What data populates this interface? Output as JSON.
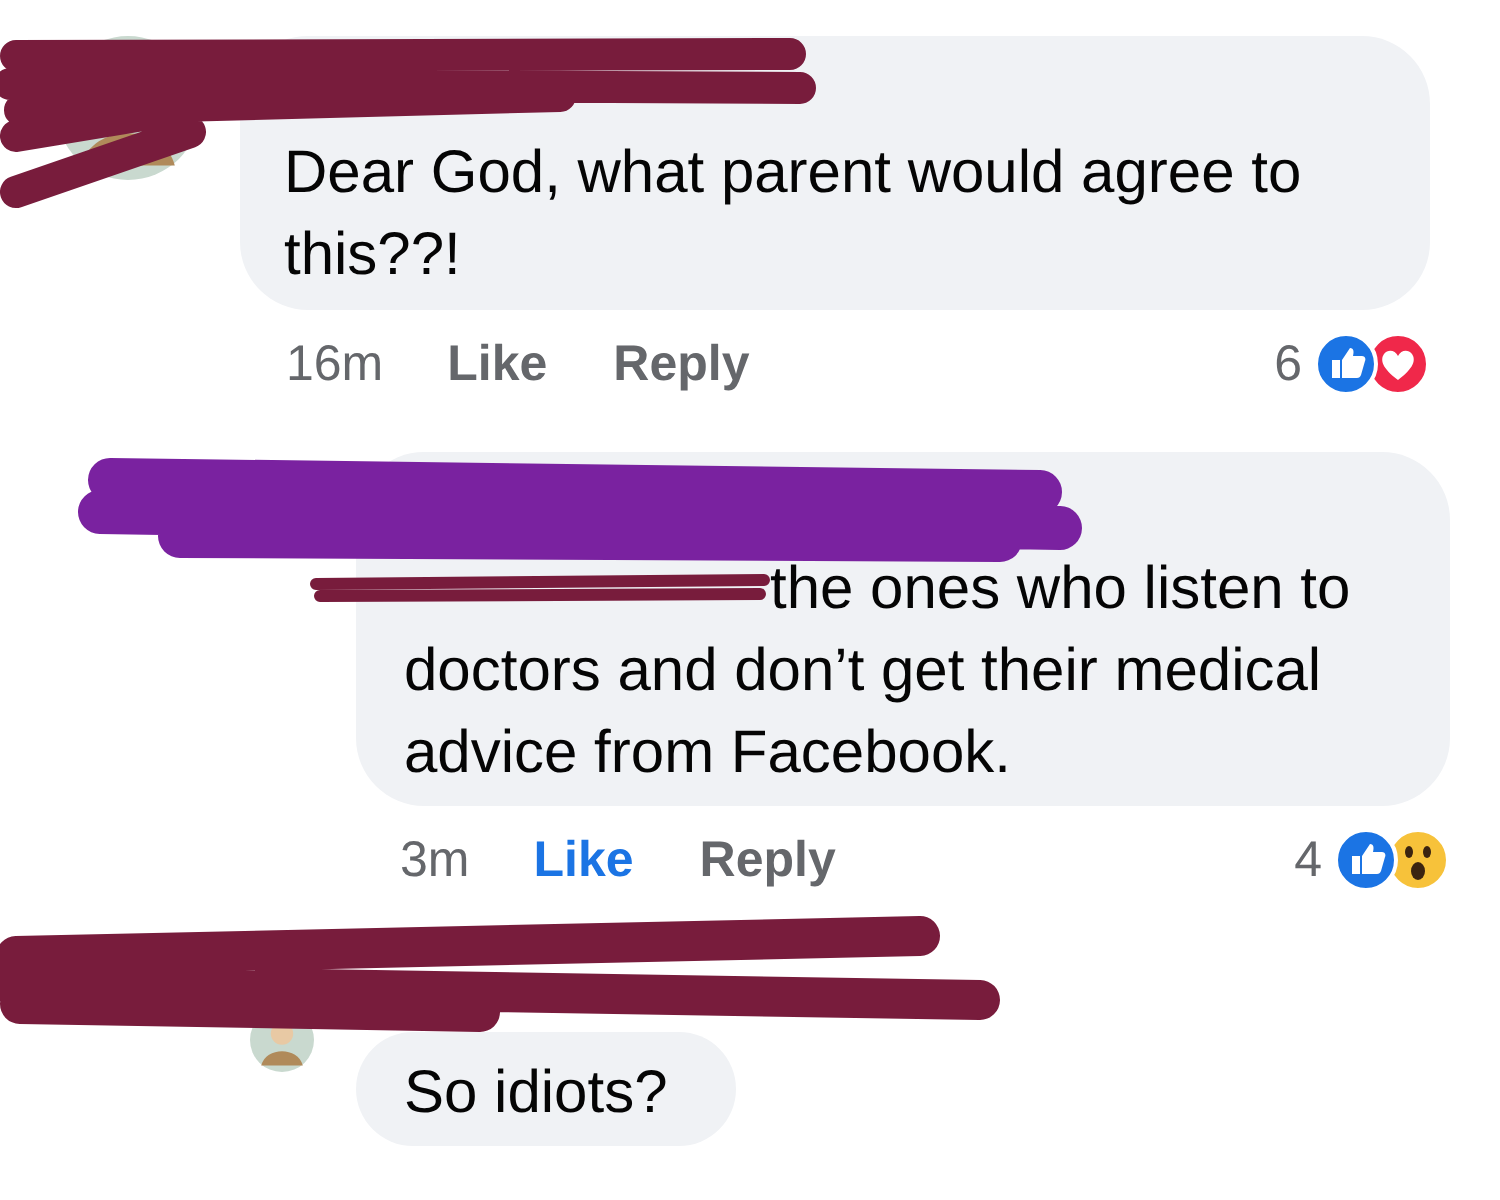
{
  "comments": [
    {
      "text": "Dear God, what parent would agree to this??!",
      "time": "16m",
      "like": "Like",
      "liked": false,
      "reply": "Reply",
      "count": "6",
      "reactions": [
        {
          "kind": "like"
        },
        {
          "kind": "love"
        }
      ],
      "reply_level": false,
      "avatar": true
    },
    {
      "text": "the ones who listen to doctors and don’t get their medical advice from Facebook.",
      "time": "3m",
      "like": "Like",
      "liked": true,
      "reply": "Reply",
      "count": "4",
      "reactions": [
        {
          "kind": "like"
        },
        {
          "kind": "wow"
        }
      ],
      "reply_level": true,
      "avatar": false
    },
    {
      "text": "So idiots?",
      "reply_level": true,
      "avatar": true
    }
  ],
  "scribbles": [
    {
      "color": "#781c3c"
    },
    {
      "color": "#7a22a0"
    },
    {
      "color": "#781c3c"
    },
    {
      "color": "#781c3c"
    }
  ]
}
